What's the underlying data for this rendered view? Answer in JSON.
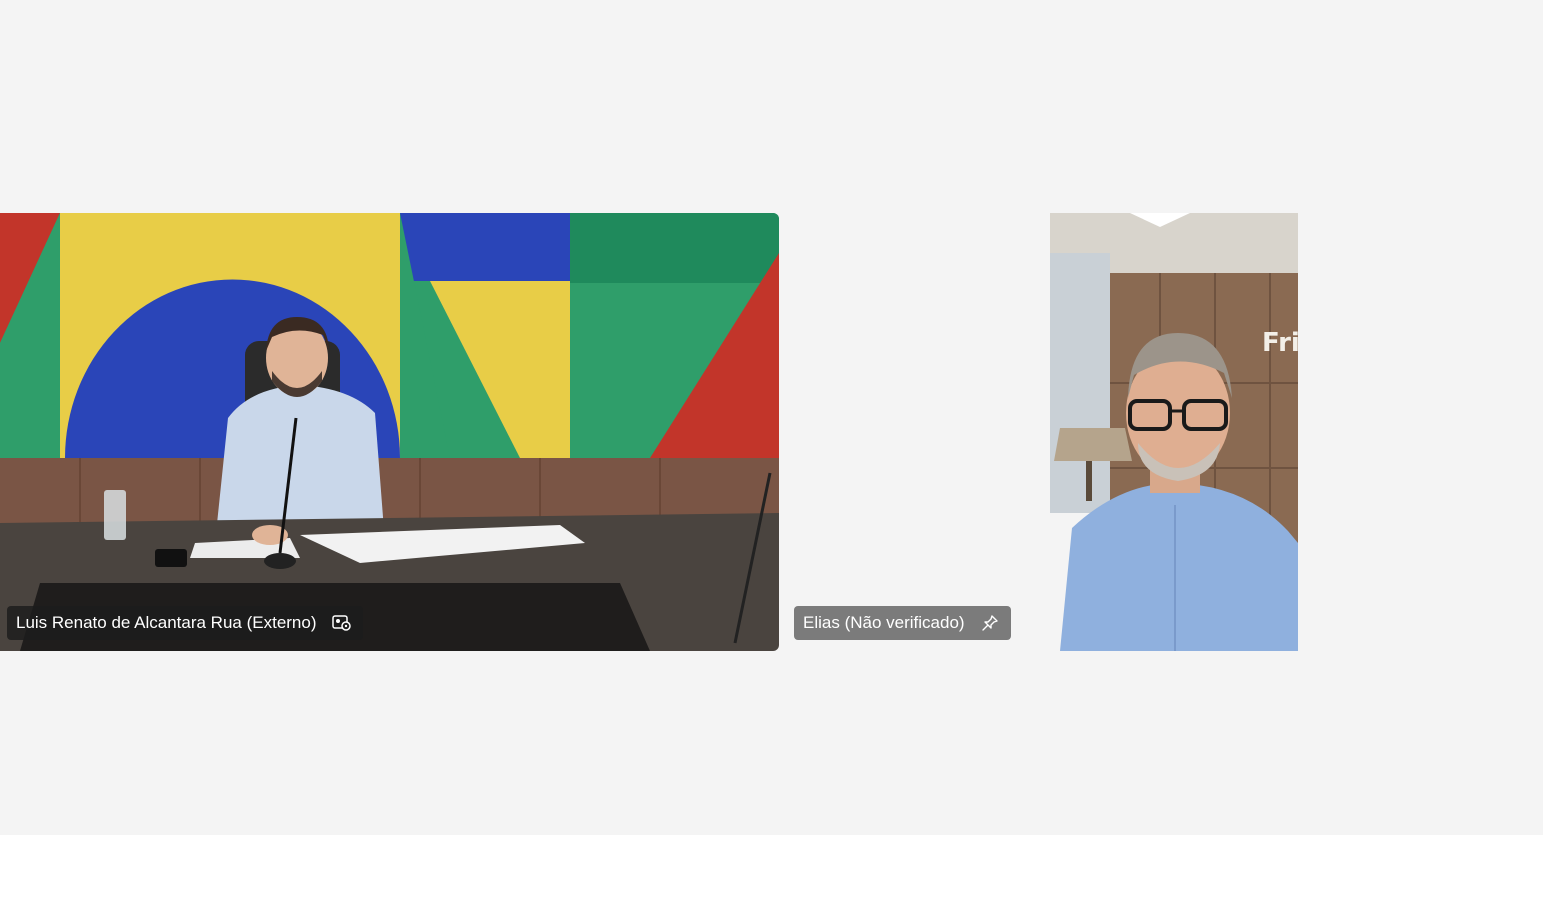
{
  "participants": [
    {
      "name": "Luis Renato de Alcantara Rua (Externo)",
      "status_icon": "video-effects-icon"
    },
    {
      "name": "Elias (Não verificado)",
      "status_icon": "pin-icon",
      "background_sign": "Fri"
    }
  ],
  "colors": {
    "stage_background": "#f4f4f4",
    "bottom_bar": "#ffffff",
    "name_tag_dark": "#1c1c1c",
    "name_tag_grey": "#707070",
    "wall_red": "#c2352a",
    "wall_yellow": "#e8cd47",
    "wall_blue": "#2a45b8",
    "wall_green": "#2f9e6a"
  }
}
